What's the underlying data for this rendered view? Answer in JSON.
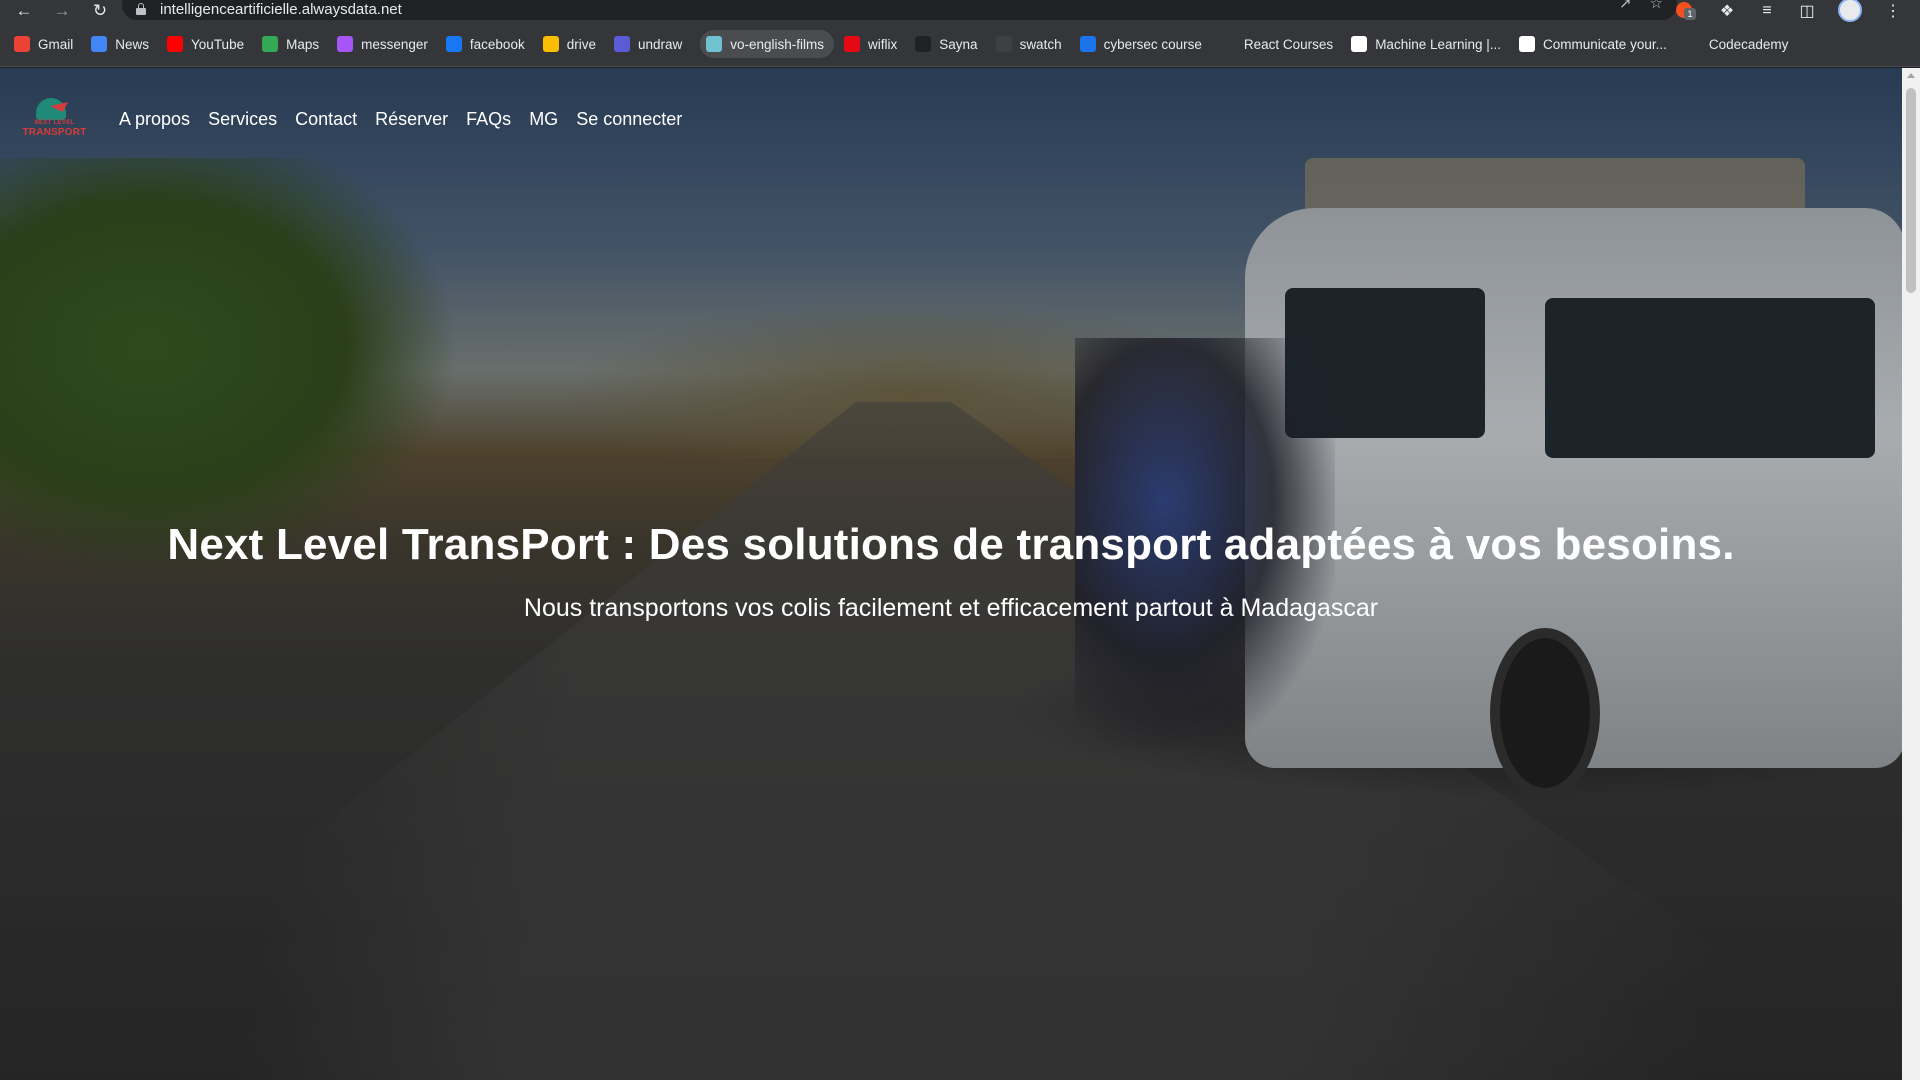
{
  "browser": {
    "url": "intelligenceartificielle.alwaysdata.net",
    "extension_badge_count": "1",
    "bookmarks": [
      {
        "label": "Gmail",
        "icon": "gmail-icon",
        "color": "#ea4335"
      },
      {
        "label": "News",
        "icon": "google-news-icon",
        "color": "#4285f4"
      },
      {
        "label": "YouTube",
        "icon": "youtube-icon",
        "color": "#ff0000"
      },
      {
        "label": "Maps",
        "icon": "maps-icon",
        "color": "#34a853"
      },
      {
        "label": "messenger",
        "icon": "messenger-icon",
        "color": "#a855f7"
      },
      {
        "label": "facebook",
        "icon": "facebook-icon",
        "color": "#1877f2"
      },
      {
        "label": "drive",
        "icon": "drive-icon",
        "color": "#fbbc04"
      },
      {
        "label": "undraw",
        "icon": "undraw-icon",
        "color": "#5b5bd6"
      },
      {
        "label": "vo-english-films",
        "icon": "vo-films-icon",
        "color": "#6fc2d0"
      },
      {
        "label": "wiflix",
        "icon": "wiflix-icon",
        "color": "#e50914"
      },
      {
        "label": "Sayna",
        "icon": "sayna-icon",
        "color": "#202124"
      },
      {
        "label": "swatch",
        "icon": "swatch-icon",
        "color": "#3c4043"
      },
      {
        "label": "cybersec course",
        "icon": "cybersec-icon",
        "color": "#1a73e8"
      },
      {
        "label": "React Courses",
        "icon": "react-courses-icon",
        "color": "#35363a"
      },
      {
        "label": "Machine Learning |...",
        "icon": "google-icon",
        "color": "#ffffff"
      },
      {
        "label": "Communicate your...",
        "icon": "google-g-icon",
        "color": "#ffffff"
      },
      {
        "label": "Codecademy",
        "icon": "codecademy-icon",
        "color": "#35363a"
      }
    ]
  },
  "site": {
    "logo": {
      "line1": "NEXT LEVEL",
      "line2": "TRANSPORT"
    },
    "nav": [
      "A propos",
      "Services",
      "Contact",
      "Réserver",
      "FAQs",
      "MG",
      "Se connecter"
    ],
    "hero_title": "Next Level TransPort : Des solutions de transport adaptées à vos besoins.",
    "hero_subtitle": "Nous transportons vos colis facilement et efficacement partout à Madagascar"
  }
}
